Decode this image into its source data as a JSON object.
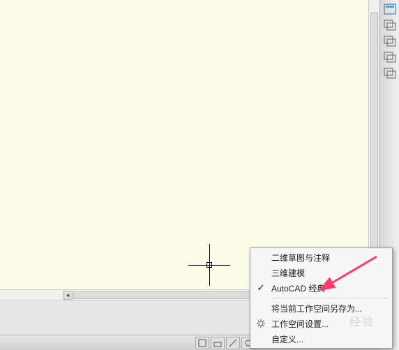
{
  "menu": {
    "items": [
      {
        "label": "二维草图与注释",
        "checked": false
      },
      {
        "label": "三维建模",
        "checked": false
      },
      {
        "label": "AutoCAD 经典",
        "checked": true
      }
    ],
    "saveWorkspaceAs": "将当前工作空间另存为...",
    "workspaceSettings": "工作空间设置...",
    "customize": "自定义..."
  },
  "watermark": "经验"
}
